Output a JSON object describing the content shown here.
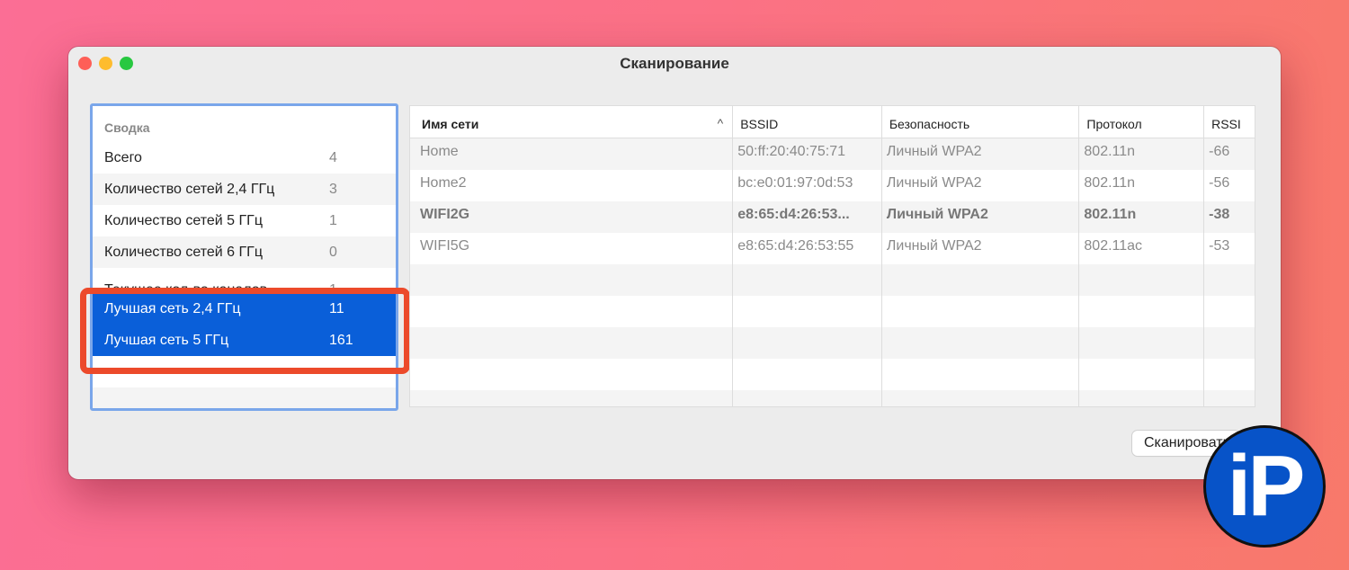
{
  "window": {
    "title": "Сканирование"
  },
  "summary": {
    "header": "Сводка",
    "rows": [
      {
        "label": "Всего",
        "value": "4"
      },
      {
        "label": "Количество сетей 2,4 ГГц",
        "value": "3"
      },
      {
        "label": "Количество сетей 5 ГГц",
        "value": "1"
      },
      {
        "label": "Количество сетей 6 ГГц",
        "value": "0"
      },
      {
        "label": "Текущее кол-во каналов",
        "value": "1"
      },
      {
        "label": "Лучшая сеть 2,4 ГГц",
        "value": "11"
      },
      {
        "label": "Лучшая сеть 5 ГГц",
        "value": "161"
      }
    ]
  },
  "table": {
    "columns": [
      "Имя сети",
      "BSSID",
      "Безопасность",
      "Протокол",
      "RSSI"
    ],
    "sort_indicator": "^",
    "rows": [
      [
        "Home",
        "50:ff:20:40:75:71",
        "Личный WPA2",
        "802.11n",
        "-66"
      ],
      [
        "Home2",
        "bc:e0:01:97:0d:53",
        "Личный WPA2",
        "802.11n",
        "-56"
      ],
      [
        "WIFI2G",
        "e8:65:d4:26:53...",
        "Личный WPA2",
        "802.11n",
        "-38"
      ],
      [
        "WIFI5G",
        "e8:65:d4:26:53:55",
        "Личный WPA2",
        "802.11ac",
        "-53"
      ]
    ]
  },
  "scan_button": "Сканировать",
  "logo": "iP"
}
